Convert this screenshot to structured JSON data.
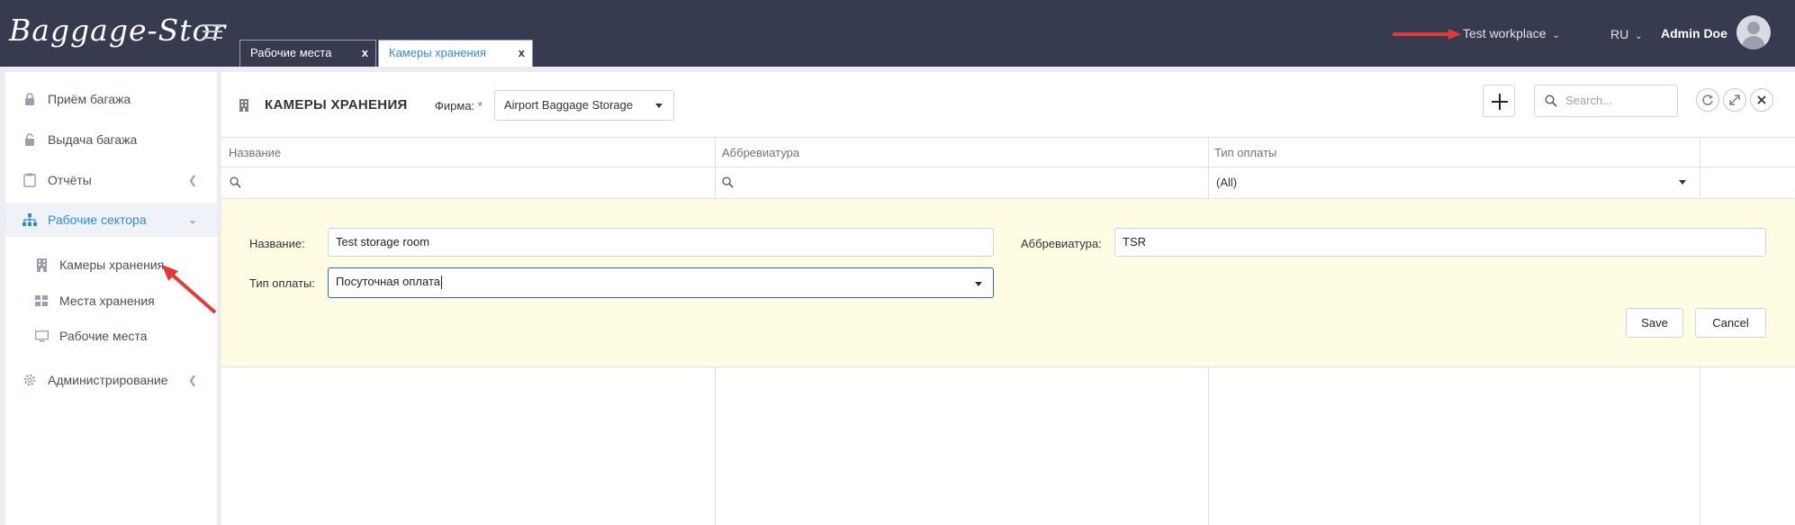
{
  "app": {
    "logo": "Baggage-Stor"
  },
  "tabs": [
    {
      "label": "Рабочие места",
      "close": "x"
    },
    {
      "label": "Камеры хранения",
      "close": "x"
    }
  ],
  "header": {
    "workplace": "Test workplace",
    "language": "RU",
    "user_name": "Admin Doe"
  },
  "sidebar": {
    "items": [
      {
        "label": "Приём багажа",
        "icon": "lock-icon"
      },
      {
        "label": "Выдача багажа",
        "icon": "unlock-icon"
      },
      {
        "label": "Отчёты",
        "icon": "clipboard-icon"
      },
      {
        "label": "Рабочие сектора",
        "icon": "sitemap-icon"
      },
      {
        "label": "Администрирование",
        "icon": "gear-icon"
      }
    ],
    "sub_items": [
      {
        "label": "Камеры хранения",
        "icon": "building-icon"
      },
      {
        "label": "Места хранения",
        "icon": "grid-icon"
      },
      {
        "label": "Рабочие места",
        "icon": "monitor-icon"
      }
    ]
  },
  "page": {
    "title": "КАМЕРЫ ХРАНЕНИЯ",
    "firm_label": "Фирма:",
    "firm_required": "*",
    "firm_value": "Airport Baggage Storage",
    "search_placeholder": "Search..."
  },
  "grid": {
    "columns": [
      "Название",
      "Аббревиатура",
      "Тип оплаты"
    ],
    "payment_filter": "(All)"
  },
  "form": {
    "name_label": "Название:",
    "name_value": "Test storage room",
    "abbr_label": "Аббревиатура:",
    "abbr_value": "TSR",
    "payment_label": "Тип оплаты:",
    "payment_value": "Посуточная оплата",
    "save_label": "Save",
    "cancel_label": "Cancel"
  },
  "colors": {
    "topbar": "#363b4f",
    "accent": "#2e8ad7",
    "form_bg": "#fefde4",
    "arrow": "#e53935"
  }
}
